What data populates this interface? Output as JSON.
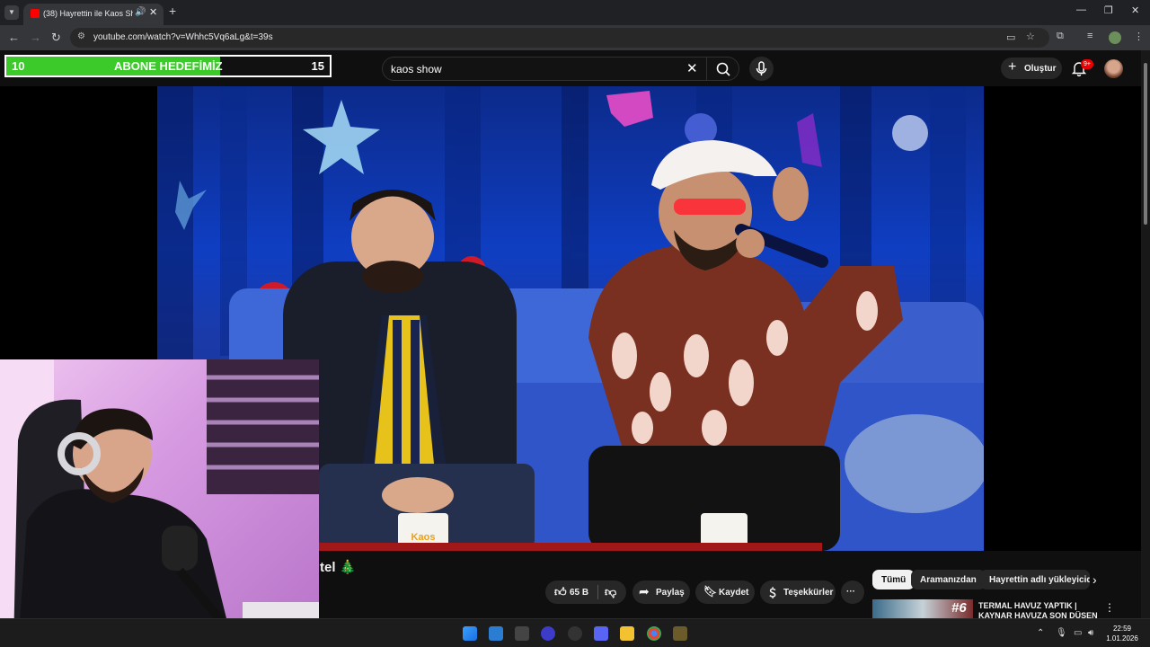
{
  "browser": {
    "tab_title": "(38) Hayrettin ile Kaos Show",
    "url": "youtube.com/watch?v=Whhc5Vq6aLg&t=39s",
    "tab_close": "✕",
    "new_tab": "+"
  },
  "goal_overlay": {
    "start": "10",
    "label": "ABONE HEDEFİMİZ",
    "target": "15",
    "progress_fraction": 0.66
  },
  "youtube": {
    "search_value": "kaos show",
    "create_label": "Oluştur",
    "notification_badge": "9+",
    "title_fragment": "tel 🎄",
    "actions": {
      "like_count": "65 B",
      "share_label": "Paylaş",
      "save_label": "Kaydet",
      "thanks_label": "Teşekkürler",
      "more_label": "···"
    },
    "chips": [
      "Tümü",
      "Aramanızdan",
      "Hayrettin adlı yükleyicid"
    ],
    "suggestion": {
      "rank": "#6",
      "title": "TERMAL HAVUZ YAPTIK | KAYNAR HAVUZA SON DÜŞEN"
    },
    "scene_mug_text": "Kaos"
  },
  "taskbar": {
    "time": "22:59",
    "date": "1.01.2026"
  },
  "colors": {
    "goal_fill": "#3cc92a",
    "youtube_red": "#ff0000",
    "background": "#0f0f0f"
  }
}
